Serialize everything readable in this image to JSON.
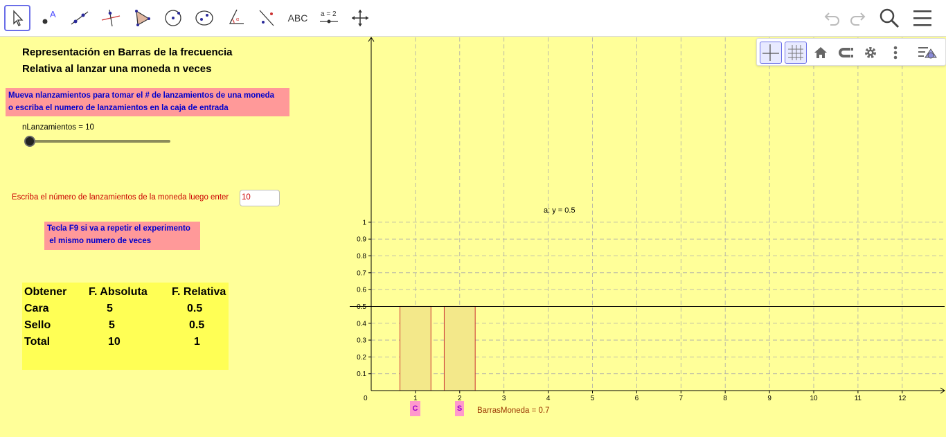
{
  "toolbar": {
    "tools": [
      {
        "name": "move",
        "label": ""
      },
      {
        "name": "point",
        "label": ""
      },
      {
        "name": "line",
        "label": ""
      },
      {
        "name": "perpendicular",
        "label": ""
      },
      {
        "name": "polygon",
        "label": ""
      },
      {
        "name": "circle",
        "label": ""
      },
      {
        "name": "ellipse",
        "label": ""
      },
      {
        "name": "angle",
        "label": ""
      },
      {
        "name": "reflect",
        "label": ""
      },
      {
        "name": "text",
        "label": "ABC"
      },
      {
        "name": "slider",
        "label": "a = 2"
      },
      {
        "name": "move-graphics",
        "label": ""
      }
    ]
  },
  "panel": {
    "title_line1": "Representación en Barras de la frecuencia",
    "title_line2": "Relativa al lanzar una moneda n veces",
    "instruction_line1": "Mueva nlanzamientos para tomar el # de lanzamientos de una moneda",
    "instruction_line2": "o escriba  el numero de lanzamientos en la caja de entrada",
    "slider_label": "nLanzamientos = 10",
    "slider_value": 10,
    "input_label": "Escriba el número de lanzamientos de la moneda luego enter",
    "input_value": "10",
    "f9_line1": "Tecla F9 si va a repetir el experimento",
    "f9_line2": " el mismo numero de veces"
  },
  "table": {
    "headers": [
      "Obtener",
      "F. Absoluta",
      "F. Relativa"
    ],
    "rows": [
      [
        "Cara",
        "5",
        "0.5"
      ],
      [
        "Sello",
        "5",
        "0.5"
      ],
      [
        "Total",
        "10",
        "1"
      ]
    ]
  },
  "graph": {
    "line_label": "a: y = 0.5",
    "var_label": "BarrasMoneda = 0.7",
    "tag_c": "C",
    "tag_s": "S",
    "x_ticks": [
      "1",
      "2",
      "3",
      "4",
      "5",
      "6",
      "7",
      "8",
      "9",
      "10",
      "11",
      "12"
    ],
    "y_ticks": [
      "0.1",
      "0.2",
      "0.3",
      "0.4",
      "0.5",
      "0.6",
      "0.7",
      "0.8",
      "0.9",
      "1"
    ],
    "origin_label": "0",
    "colors": {
      "bar_fill": "#f3e88a",
      "bar_stroke": "#cc3333",
      "grid": "#aaaaaa"
    }
  },
  "chart_data": {
    "type": "bar",
    "categories": [
      "C",
      "S"
    ],
    "x": [
      1,
      2
    ],
    "values": [
      0.5,
      0.5
    ],
    "bar_width": 0.7,
    "xlim": [
      -0.15,
      13
    ],
    "ylim": [
      0,
      1.05
    ],
    "hline": 0.5,
    "grid": true
  }
}
